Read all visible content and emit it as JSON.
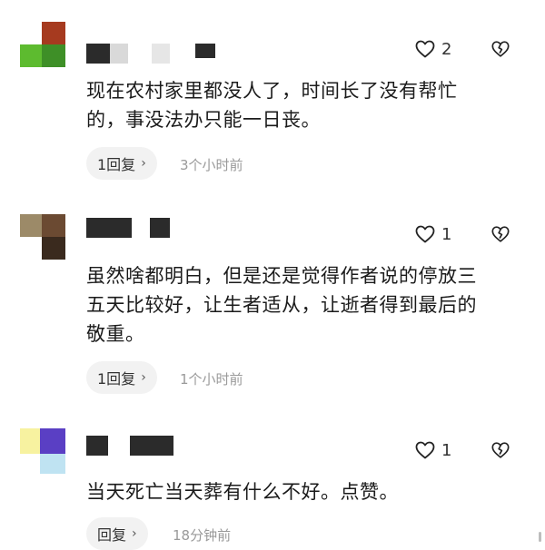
{
  "comments": [
    {
      "likes": "2",
      "text_lines": [
        "现在农村家里都没人了，时间长了没有帮忙",
        "的，事没法办只能一日丧。"
      ],
      "reply_label": "1回复",
      "time": "3个小时前"
    },
    {
      "likes": "1",
      "text_lines": [
        "虽然啥都明白，但是还是觉得作者说的停放三",
        "五天比较好，让生者适从，让逝者得到最后的",
        "敬重。"
      ],
      "reply_label": "1回复",
      "time": "1个小时前"
    },
    {
      "likes": "1",
      "text_lines": [
        "当天死亡当天葬有什么不好。点赞。"
      ],
      "reply_label": "回复",
      "time": "18分钟前"
    }
  ],
  "icons": {
    "like": "heart-outline-icon",
    "dislike": "broken-heart-icon",
    "chevron": "chevron-right-icon"
  },
  "colors": {
    "reply_bg": "#f2f2f2",
    "time_text": "#9a9a9a",
    "redaction": "#2b2b2b"
  }
}
